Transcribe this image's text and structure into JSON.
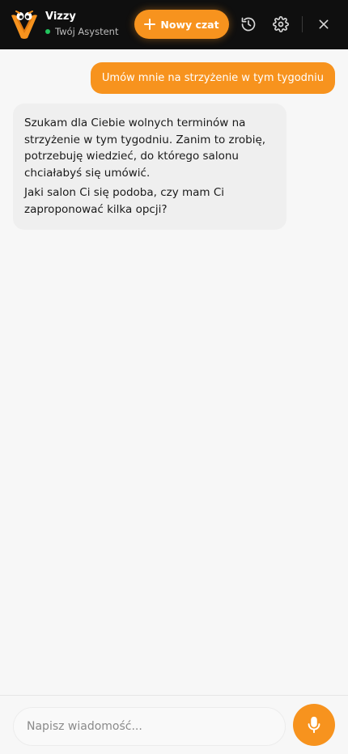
{
  "header": {
    "brand_name": "Vizzy",
    "brand_subtitle": "Twój Asystent",
    "new_chat_label": "Nowy czat",
    "icons": [
      "logo-icon",
      "plus-icon",
      "history-icon",
      "gear-icon",
      "close-icon"
    ],
    "accent_color": "#f7931e",
    "online_color": "#22c55e"
  },
  "chat": {
    "messages": [
      {
        "role": "user",
        "text": "Umów mnie na strzyżenie w tym tygodniu"
      },
      {
        "role": "assistant",
        "paragraphs": [
          "Szukam dla Ciebie wolnych terminów na strzyżenie w tym tygodniu. Zanim to zrobię, potrzebuję wiedzieć, do którego salonu chciałabyś się umówić.",
          "Jaki salon Ci się podoba, czy mam Ci zaproponować kilka opcji?"
        ]
      }
    ]
  },
  "composer": {
    "placeholder": "Napisz wiadomość...",
    "value": "",
    "mic_icon": "microphone-icon"
  }
}
